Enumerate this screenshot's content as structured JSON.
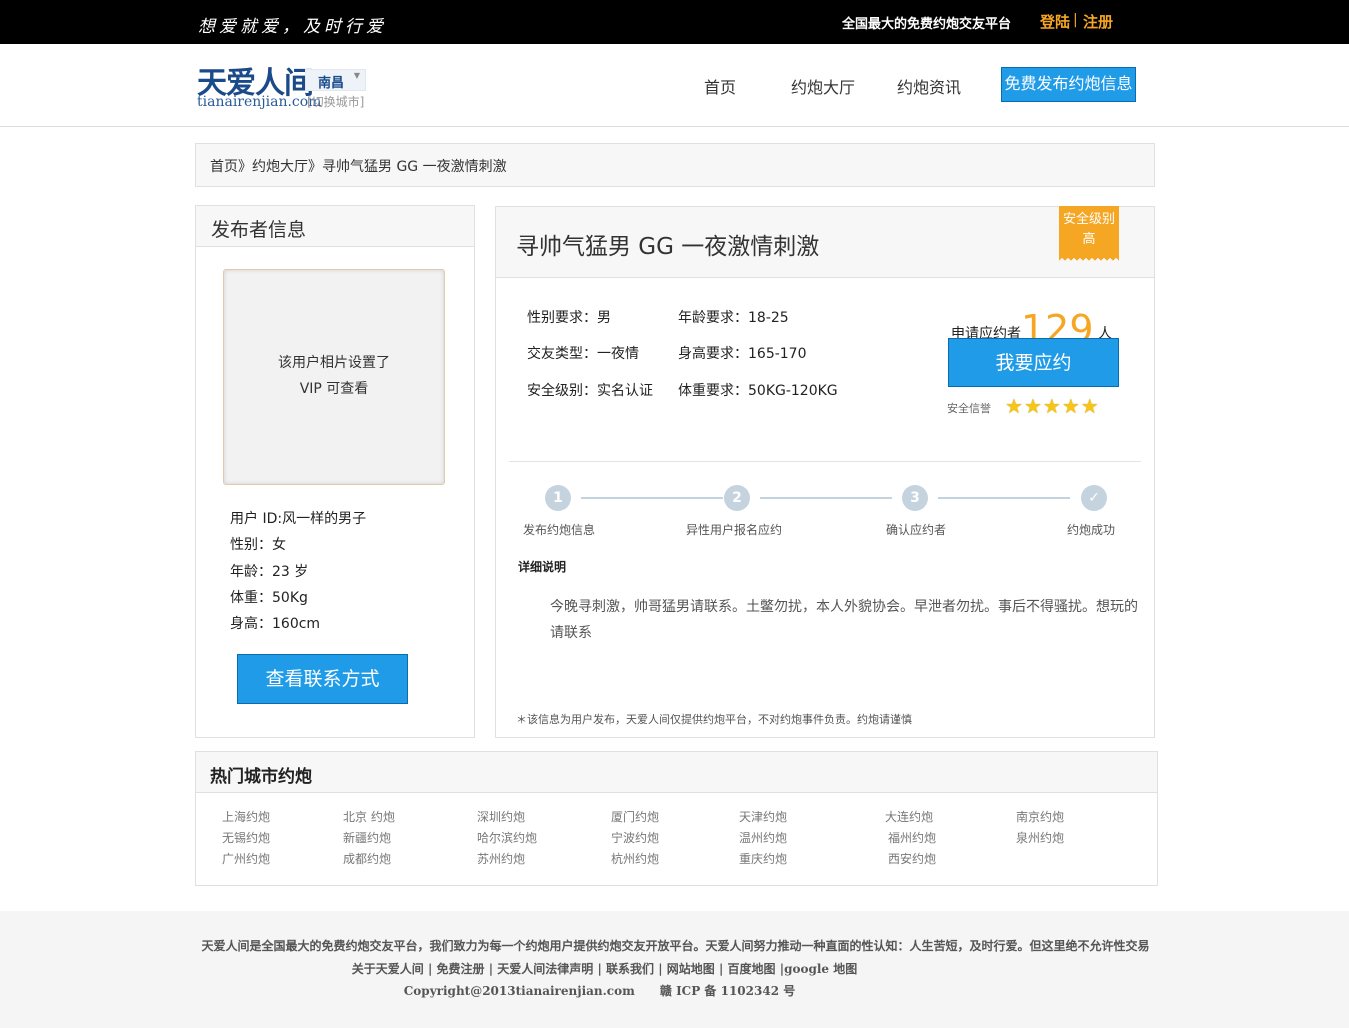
{
  "topbar": {
    "slogan": "想爱就爱，及时行爱",
    "platform": "全国最大的免费约炮交友平台",
    "login": "登陆",
    "separator": "|",
    "register": "注册"
  },
  "header": {
    "logo_cn": "天爱人间",
    "logo_en": "tianairenjian.com",
    "city": "南昌",
    "switch_city": "[切换城市]",
    "nav": [
      "首页",
      "约炮大厅",
      "约炮资讯"
    ],
    "publish": "免费发布约炮信息"
  },
  "breadcrumb": "首页》约炮大厅》寻帅气猛男 GG 一夜激情刺激",
  "publisher": {
    "heading": "发布者信息",
    "photo_line1": "该用户相片设置了",
    "photo_line2": "VIP 可查看",
    "user_id": "用户 ID:风一样的男子",
    "gender": "性别：女",
    "age": "年龄：23 岁",
    "weight": "体重：50Kg",
    "height": "身高：160cm",
    "contact": "查看联系方式"
  },
  "detail": {
    "title": "寻帅气猛男 GG 一夜激情刺激",
    "safety_label": "安全级别",
    "safety_value": "高",
    "gender_req": "性别要求：男",
    "age_req": "年龄要求：18-25",
    "type_req": "交友类型：一夜情",
    "height_req": "身高要求：165-170",
    "safe_req": "安全级别：实名认证",
    "weight_req": "体重要求：50KG-120KG",
    "applicants_prefix": "申请应约者",
    "applicants_count": "129",
    "applicants_suffix": "人",
    "apply": "我要应约",
    "credit_label": "安全信誉",
    "credit_stars": 5,
    "steps": [
      {
        "num": "1",
        "label": "发布约炮信息"
      },
      {
        "num": "2",
        "label": "异性用户报名应约"
      },
      {
        "num": "3",
        "label": "确认应约者"
      },
      {
        "num": "✓",
        "label": "约炮成功"
      }
    ],
    "desc_title": "详细说明",
    "desc_text": "今晚寻刺激，帅哥猛男请联系。土鳖勿扰，本人外貌协会。早泄者勿扰。事后不得骚扰。想玩的请联系",
    "disclaimer": "＊该信息为用户发布，天爱人间仅提供约炮平台，不对约炮事件负责。约炮请谨慎"
  },
  "hot_cities": {
    "heading": "热门城市约炮",
    "rows": [
      [
        "上海约炮",
        "北京 约炮",
        "深圳约炮",
        "厦门约炮",
        "天津约炮",
        "大连约炮",
        "南京约炮"
      ],
      [
        "无锡约炮",
        "新疆约炮",
        "哈尔滨约炮",
        "宁波约炮",
        "温州约炮",
        "福州约炮",
        "泉州约炮"
      ],
      [
        "广州约炮",
        "成都约炮",
        "苏州约炮",
        "杭州约炮",
        "重庆约炮",
        "西安约炮"
      ]
    ]
  },
  "footer": {
    "line1": "天爱人间是全国最大的免费约炮交友平台，我们致力为每一个约炮用户提供约炮交友开放平台。天爱人间努力推动一种直面的性认知：人生苦短，及时行爱。但这里绝不允许性交易",
    "links": [
      "关于天爱人间",
      "免费注册",
      "天爱人间法律声明",
      "联系我们",
      "网站地图",
      "百度地图",
      "google 地图"
    ],
    "copyright": "Copyright@2013tianairenjian.com",
    "icp": "赣 ICP 备 1102342 号"
  },
  "colors": {
    "accent_blue": "#1f9be8",
    "orange": "#f5a623"
  }
}
